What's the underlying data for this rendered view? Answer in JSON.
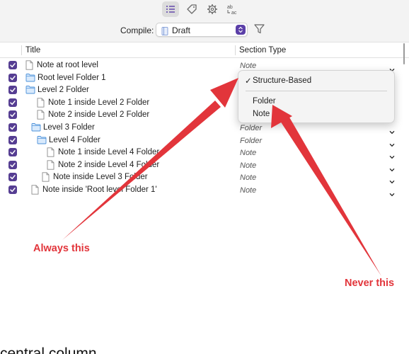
{
  "toolbar": {
    "icons": [
      "list-icon",
      "tag-icon",
      "gear-icon",
      "spell-check-icon"
    ],
    "spell_label": "ab"
  },
  "compile": {
    "label": "Compile:",
    "selected": "Draft"
  },
  "table": {
    "col_title": "Title",
    "col_section_type": "Section Type",
    "rows": [
      {
        "label": "Note at root level",
        "type": "Note",
        "kind": "note",
        "indent": 0
      },
      {
        "label": "Root level Folder 1",
        "type": "",
        "kind": "folder",
        "indent": 0
      },
      {
        "label": "Level 2 Folder",
        "type": "",
        "kind": "folder",
        "indent": 1
      },
      {
        "label": "Note 1 inside Level 2 Folder",
        "type": "",
        "kind": "note",
        "indent": 2
      },
      {
        "label": "Note 2 inside Level 2 Folder",
        "type": "",
        "kind": "note",
        "indent": 2
      },
      {
        "label": "Level 3 Folder",
        "type": "Folder",
        "kind": "folder",
        "indent": 2
      },
      {
        "label": "Level 4 Folder",
        "type": "Folder",
        "kind": "folder",
        "indent": 3
      },
      {
        "label": "Note 1 inside Level 4 Folder",
        "type": "Note",
        "kind": "note",
        "indent": 4
      },
      {
        "label": "Note 2 inside Level 4 Folder",
        "type": "Note",
        "kind": "note",
        "indent": 4
      },
      {
        "label": "Note inside Level 3 Folder",
        "type": "Note",
        "kind": "note",
        "indent": 3
      },
      {
        "label": "Note inside 'Root level Folder 1'",
        "type": "Note",
        "kind": "note",
        "indent": 1
      }
    ]
  },
  "menu": {
    "items": [
      {
        "label": "Structure-Based",
        "checked": true
      },
      {
        "label": "Folder",
        "checked": false
      },
      {
        "label": "Note",
        "checked": false
      }
    ]
  },
  "annotations": {
    "always": "Always this",
    "never": "Never this",
    "color": "#e2353b"
  },
  "bottom_text": "central column"
}
